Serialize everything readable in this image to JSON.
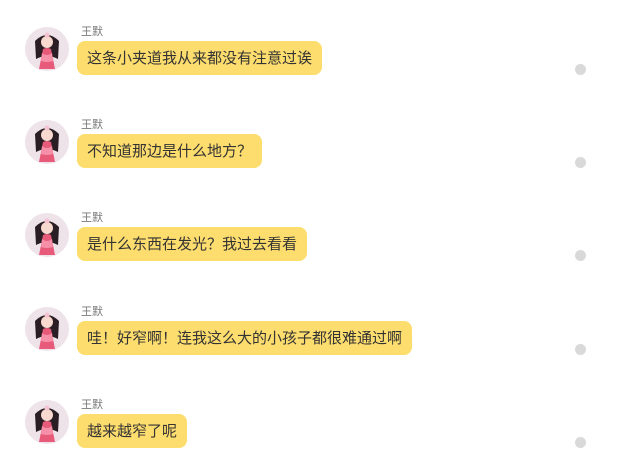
{
  "messages": [
    {
      "sender": "王默",
      "text": "这条小夹道我从来都没有注意过诶"
    },
    {
      "sender": "王默",
      "text": "不知道那边是什么地方？"
    },
    {
      "sender": "王默",
      "text": "是什么东西在发光？我过去看看"
    },
    {
      "sender": "王默",
      "text": "哇！好窄啊！连我这么大的小孩子都很难通过啊"
    },
    {
      "sender": "王默",
      "text": "越来越窄了呢"
    }
  ],
  "colors": {
    "bubble": "#fddd6e",
    "status_dot": "#d9d9d9"
  },
  "icons": {
    "avatar": "avatar-girl-pink-dress-icon",
    "status": "status-dot-icon"
  }
}
